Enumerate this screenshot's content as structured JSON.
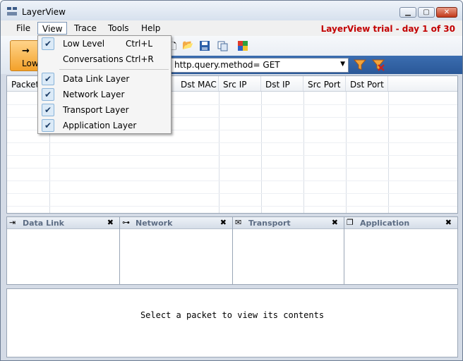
{
  "window": {
    "title": "LayerView"
  },
  "menubar": {
    "items": [
      {
        "label": "File"
      },
      {
        "label": "View"
      },
      {
        "label": "Trace"
      },
      {
        "label": "Tools"
      },
      {
        "label": "Help"
      }
    ],
    "trial_notice": "LayerView trial - day 1 of 30"
  },
  "toolbar": {
    "low_button_label": "Low",
    "filter_value": "http.query.method= GET"
  },
  "packet_table": {
    "columns": [
      "Packet",
      "Dst MAC",
      "Src IP",
      "Dst IP",
      "Src Port",
      "Dst Port"
    ]
  },
  "layer_panels": [
    {
      "title": "Data Link",
      "icon": "arrow-right-icon"
    },
    {
      "title": "Network",
      "icon": "network-icon"
    },
    {
      "title": "Transport",
      "icon": "envelope-icon"
    },
    {
      "title": "Application",
      "icon": "windows-icon"
    }
  ],
  "contents": {
    "message": "Select a packet to view its contents"
  },
  "view_menu": {
    "items": [
      {
        "label": "Low Level",
        "shortcut": "Ctrl+L",
        "checked": true
      },
      {
        "label": "Conversations",
        "shortcut": "Ctrl+R",
        "checked": false
      },
      {
        "label": "Data Link Layer",
        "shortcut": "",
        "checked": true
      },
      {
        "label": "Network Layer",
        "shortcut": "",
        "checked": true
      },
      {
        "label": "Transport Layer",
        "shortcut": "",
        "checked": true
      },
      {
        "label": "Application Layer",
        "shortcut": "",
        "checked": true
      }
    ]
  }
}
